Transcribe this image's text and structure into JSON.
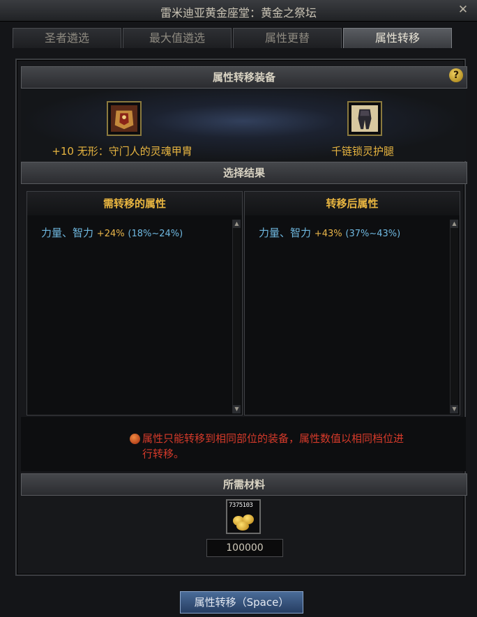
{
  "window": {
    "title": "雷米迪亚黄金座堂：黄金之祭坛"
  },
  "tabs": [
    {
      "label": "圣者遴选"
    },
    {
      "label": "最大值遴选"
    },
    {
      "label": "属性更替"
    },
    {
      "label": "属性转移"
    }
  ],
  "equip_section": {
    "title": "属性转移装备",
    "source_item": {
      "name": "+10 无形：守门人的灵魂甲胄"
    },
    "target_item": {
      "name": "千链锁灵护腿"
    }
  },
  "result_section": {
    "title": "选择结果",
    "left_panel": {
      "title": "需转移的属性",
      "stat": "力量、智力",
      "pct": "+24%",
      "range": "(18%~24%)"
    },
    "right_panel": {
      "title": "转移后属性",
      "stat": "力量、智力",
      "pct": "+43%",
      "range": "(37%~43%)"
    }
  },
  "notice": {
    "text": "属性只能转移到相同部位的装备，属性数值以相同档位进行转移。"
  },
  "materials": {
    "title": "所需材料",
    "owned": "7375103",
    "cost": "100000"
  },
  "action_button": {
    "label": "属性转移（Space）"
  },
  "colors": {
    "accent_gold": "#e8b540",
    "stat_blue": "#6fb8e0",
    "warning_red": "#d63a2a",
    "button_blue": "#3a5a88"
  }
}
